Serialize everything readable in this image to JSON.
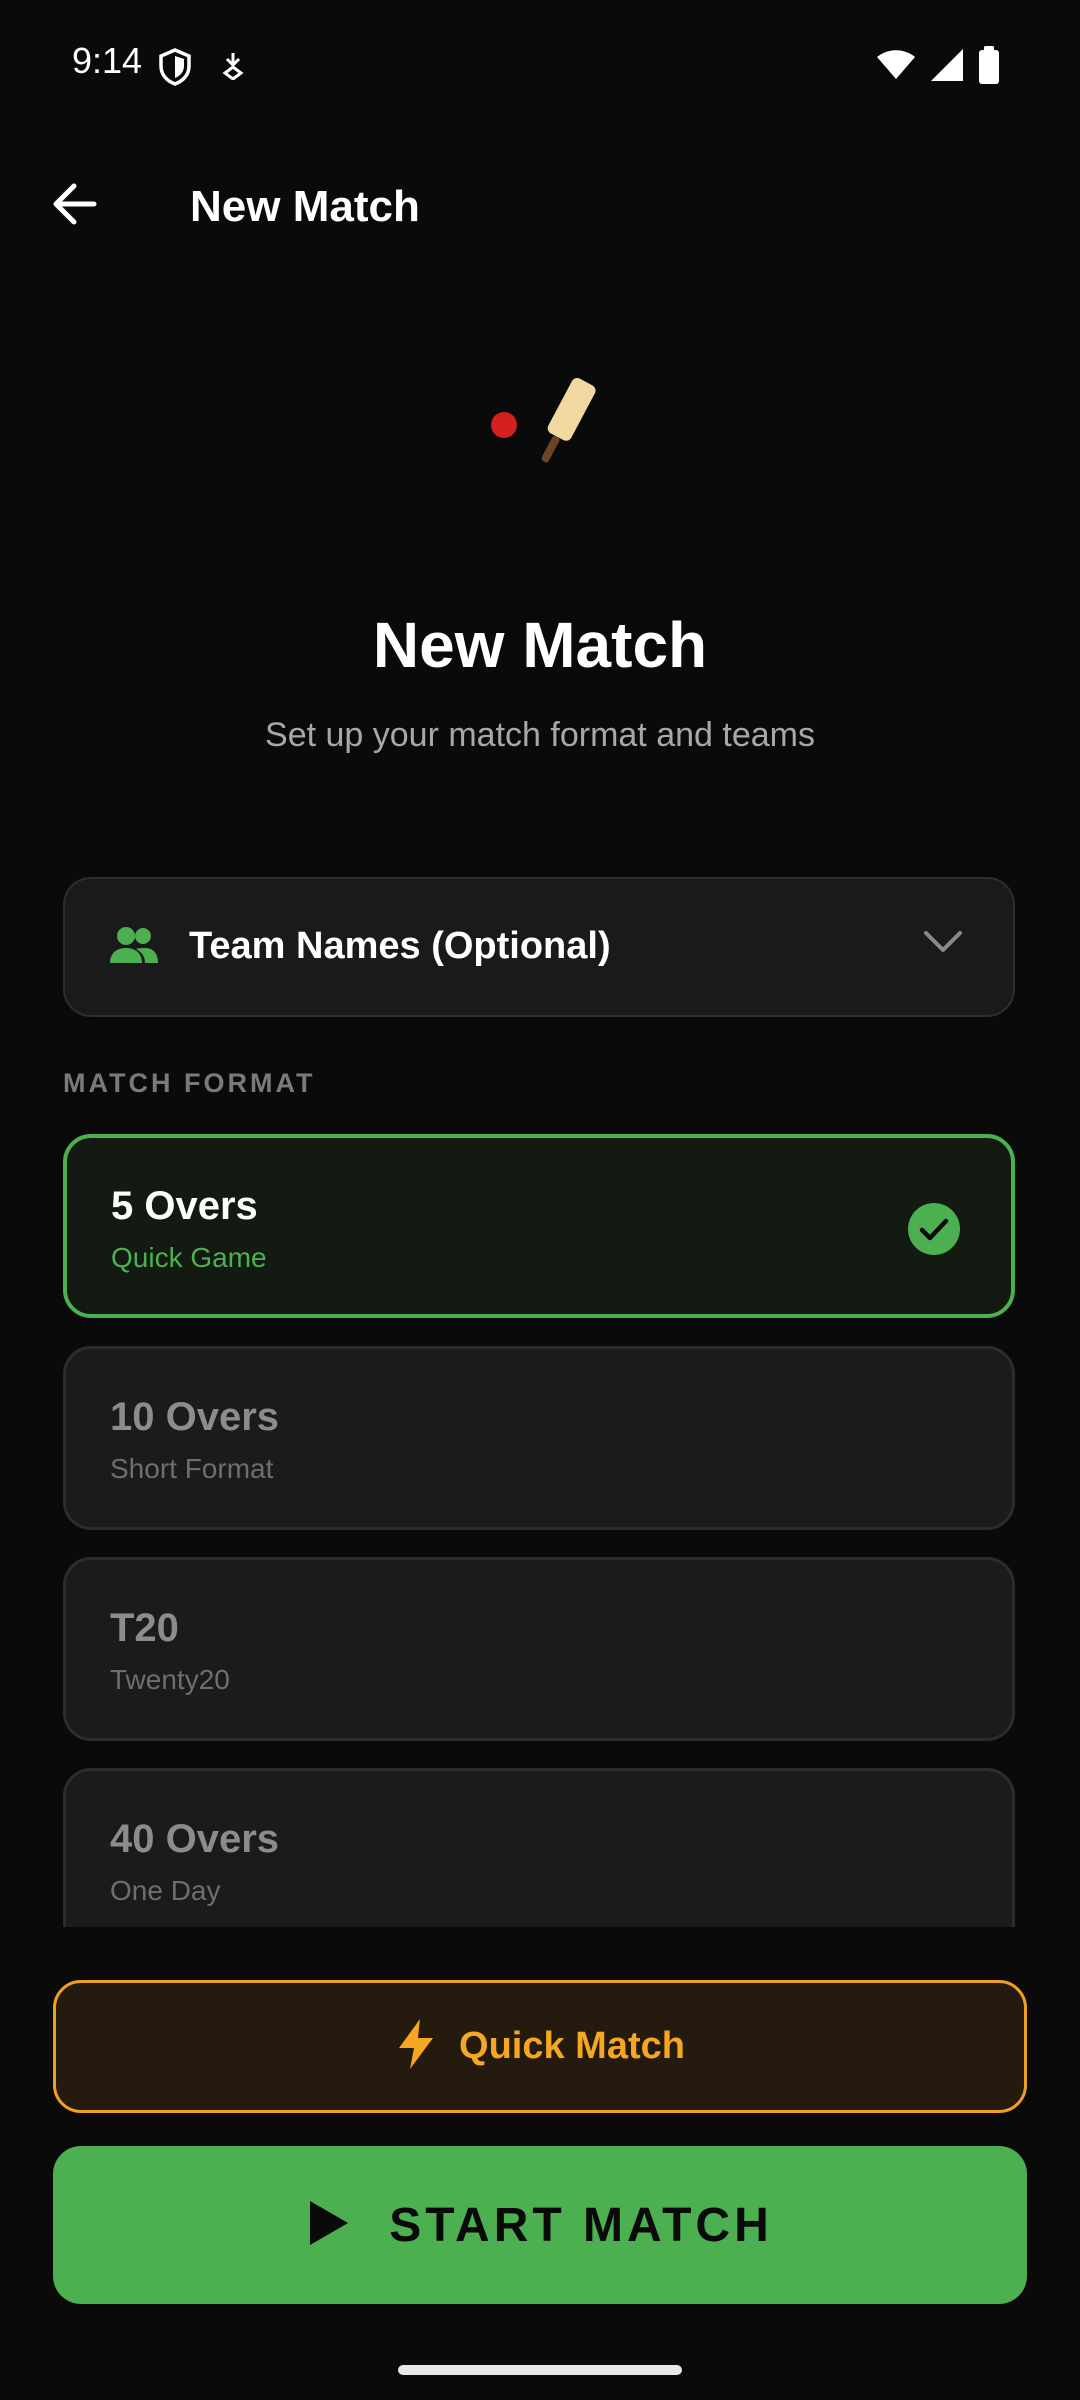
{
  "status_bar": {
    "time": "9:14",
    "left_icons": [
      "shield-icon",
      "download-notification-icon"
    ],
    "right_icons": [
      "wifi-icon",
      "signal-icon",
      "battery-icon"
    ]
  },
  "app_bar": {
    "back_icon": "arrow-left-icon",
    "title": "New Match"
  },
  "hero": {
    "icon": "cricket-bat-ball-icon",
    "title": "New Match",
    "subtitle": "Set up your match format and teams"
  },
  "team_names": {
    "icon": "group-icon",
    "label": "Team Names (Optional)",
    "chevron": "chevron-down-icon",
    "expanded": false
  },
  "match_format": {
    "section_label": "MATCH FORMAT",
    "selected_index": 0,
    "options": [
      {
        "title": "5 Overs",
        "subtitle": "Quick Game"
      },
      {
        "title": "10 Overs",
        "subtitle": "Short Format"
      },
      {
        "title": "T20",
        "subtitle": "Twenty20"
      },
      {
        "title": "40 Overs",
        "subtitle": "One Day"
      }
    ]
  },
  "actions": {
    "quick_match_label": "Quick Match",
    "quick_match_icon": "lightning-icon",
    "start_label": "START MATCH",
    "start_icon": "play-icon"
  },
  "colors": {
    "background": "#0a0a0a",
    "accent_green": "#4caf50",
    "accent_orange": "#f5a623",
    "card": "#1b1b1b"
  }
}
